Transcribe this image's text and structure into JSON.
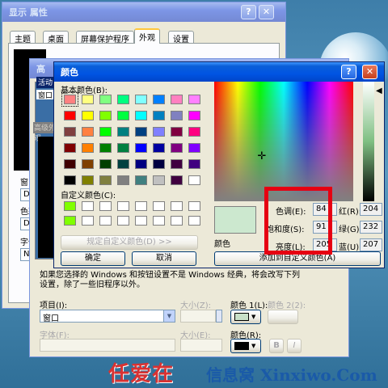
{
  "display_props": {
    "title": "显示 属性",
    "tabs": [
      "主题",
      "桌面",
      "屏幕保护程序",
      "外观",
      "设置"
    ],
    "active_tab": "外观",
    "left_labels": [
      "窗口",
      "色彩",
      "字体"
    ],
    "left_values": [
      "De",
      "De",
      "No"
    ]
  },
  "advanced_appearance": {
    "title": "高级外观",
    "preview_title": "活动",
    "preview_window": "窗口",
    "info_text": "如果您选择的 Windows 和按钮设置不是 Windows 经典，将会改写下列设置，除了一些旧程序以外。",
    "item_label": "项目(I):",
    "item_value": "窗口",
    "size_label": "大小(Z):",
    "color1_label": "颜色 1(L):",
    "color2_label": "颜色 2(2):",
    "font_label": "字体(F):",
    "font_size_label": "大小(E):",
    "font_color_label": "颜色(R):",
    "bold_label": "B",
    "italic_label": "I",
    "color1_value": "#c8e0c8"
  },
  "color_dialog": {
    "title": "颜色",
    "basic_colors_label": "基本颜色(B):",
    "custom_colors_label": "自定义颜色(C):",
    "define_custom_button": "规定自定义颜色(D) >>",
    "ok_button": "确定",
    "cancel_button": "取消",
    "add_custom_button": "添加到自定义颜色(A)",
    "color_label": "颜色",
    "solid_label": "纯色(O)",
    "hue_label": "色调(E):",
    "hue_value": "84",
    "sat_label": "饱和度(S):",
    "sat_value": "91",
    "lum_label": "亮度(L):",
    "lum_value": "205",
    "red_label": "红(R):",
    "red_value": "204",
    "green_label": "绿(G):",
    "green_value": "232",
    "blue_label": "蓝(U):",
    "blue_value": "207",
    "selected_color": "#cce8cf",
    "basic_colors": [
      "#ff8080",
      "#ffff80",
      "#80ff80",
      "#00ff80",
      "#80ffff",
      "#0080ff",
      "#ff80c0",
      "#ff80ff",
      "#ff0000",
      "#ffff00",
      "#80ff00",
      "#00ff40",
      "#00ffff",
      "#0080c0",
      "#8080c0",
      "#ff00ff",
      "#804040",
      "#ff8040",
      "#00ff00",
      "#008080",
      "#004080",
      "#8080ff",
      "#800040",
      "#ff0080",
      "#800000",
      "#ff8000",
      "#008000",
      "#008040",
      "#0000ff",
      "#0000a0",
      "#800080",
      "#8000ff",
      "#400000",
      "#804000",
      "#004000",
      "#004040",
      "#000080",
      "#000040",
      "#400040",
      "#400080",
      "#000000",
      "#808000",
      "#808040",
      "#808080",
      "#408080",
      "#c0c0c0",
      "#400040",
      "#ffffff"
    ],
    "custom_colors": [
      "#80ff00",
      "#ffffff",
      "#ffffff",
      "#ffffff",
      "#ffffff",
      "#ffffff",
      "#ffffff",
      "#ffffff",
      "#80ff00",
      "#ffffff",
      "#ffffff",
      "#ffffff",
      "#ffffff",
      "#ffffff",
      "#ffffff",
      "#ffffff"
    ]
  },
  "watermark": {
    "text1": "任爱在",
    "text2": "信息窝 Xinxiwo.Com"
  }
}
